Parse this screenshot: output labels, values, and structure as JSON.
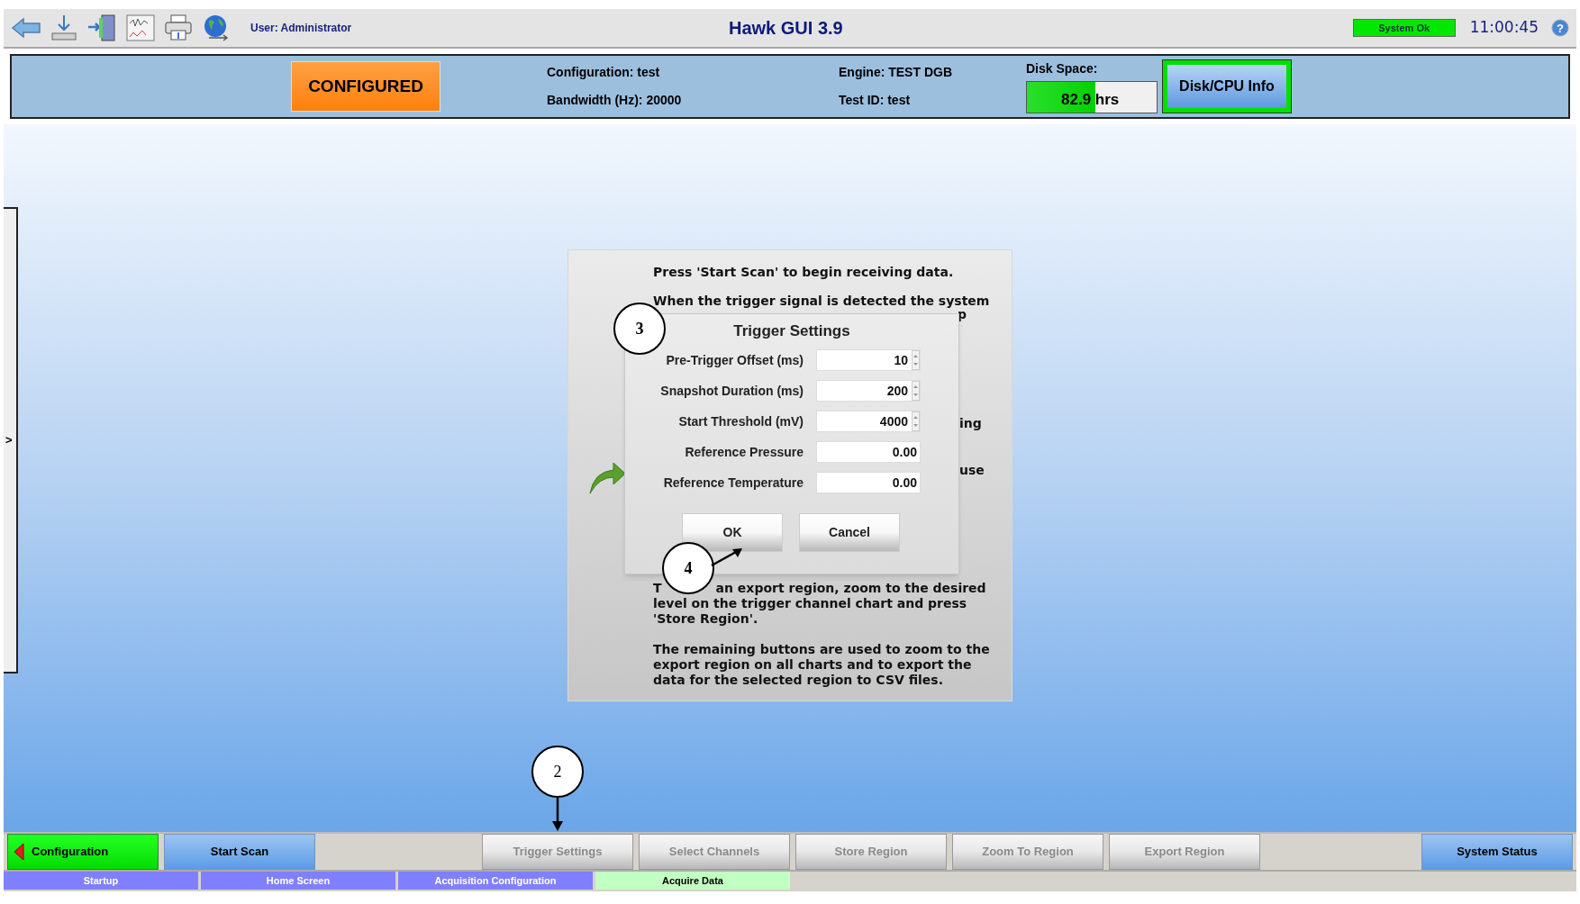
{
  "header": {
    "user": "User: Administrator",
    "title": "Hawk GUI 3.9",
    "system_status": "System Ok",
    "time": "11:00:45",
    "help": "?"
  },
  "info_panel": {
    "state": "CONFIGURED",
    "configuration": "Configuration: test",
    "bandwidth": "Bandwidth (Hz): 20000",
    "engine": "Engine: TEST DGB",
    "test_id": "Test ID: test",
    "disk": {
      "label": "Disk Space:",
      "value": "82.9",
      "unit": "hrs",
      "level": 0.53
    },
    "disk_button": "Disk/CPU Info"
  },
  "side_panel": {
    "toggle": ">"
  },
  "instructions": {
    "intro": "Press 'Start Scan' to begin receiving data.",
    "line_2": "When the trigger signal is detected the system",
    "fragment_1": "p",
    "fragment_2": "ing",
    "fragment_3": "use",
    "store_lead": "T",
    "store_text": "an export region, zoom to the desired level on the trigger channel chart and press 'Store Region'.",
    "remaining": "The remaining buttons are used to zoom to the export region on all charts and to export the data for the selected region to CSV files."
  },
  "trigger_dialog": {
    "title": "Trigger Settings",
    "fields": [
      {
        "label": "Pre-Trigger Offset (ms)",
        "value": "10",
        "kind": "spinner"
      },
      {
        "label": "Snapshot Duration (ms)",
        "value": "200",
        "kind": "spinner"
      },
      {
        "label": "Start Threshold (mV)",
        "value": "4000",
        "kind": "spinner"
      },
      {
        "label": "Reference Pressure",
        "value": "0.00",
        "kind": "plain"
      },
      {
        "label": "Reference Temperature",
        "value": "0.00",
        "kind": "plain"
      }
    ],
    "buttons": [
      "OK",
      "Cancel"
    ]
  },
  "callouts": [
    "3",
    "4",
    "2"
  ],
  "action_bar": [
    {
      "label": "Configuration",
      "kind": "back",
      "disabled": false
    },
    {
      "label": "Start Scan",
      "kind": "primary",
      "disabled": false
    },
    {
      "label": "Trigger Settings",
      "kind": "action",
      "disabled": true
    },
    {
      "label": "Select Channels",
      "kind": "action",
      "disabled": true
    },
    {
      "label": "Store Region",
      "kind": "action",
      "disabled": true
    },
    {
      "label": "Zoom To Region",
      "kind": "action",
      "disabled": true
    },
    {
      "label": "Export Region",
      "kind": "action",
      "disabled": true
    },
    {
      "label": "System Status",
      "kind": "primary",
      "disabled": false
    }
  ],
  "steps": [
    {
      "label": "Startup",
      "selected": false
    },
    {
      "label": "Home Screen",
      "selected": false
    },
    {
      "label": "Acquisition Configuration",
      "selected": false
    },
    {
      "label": "Acquire Data",
      "selected": true
    }
  ]
}
